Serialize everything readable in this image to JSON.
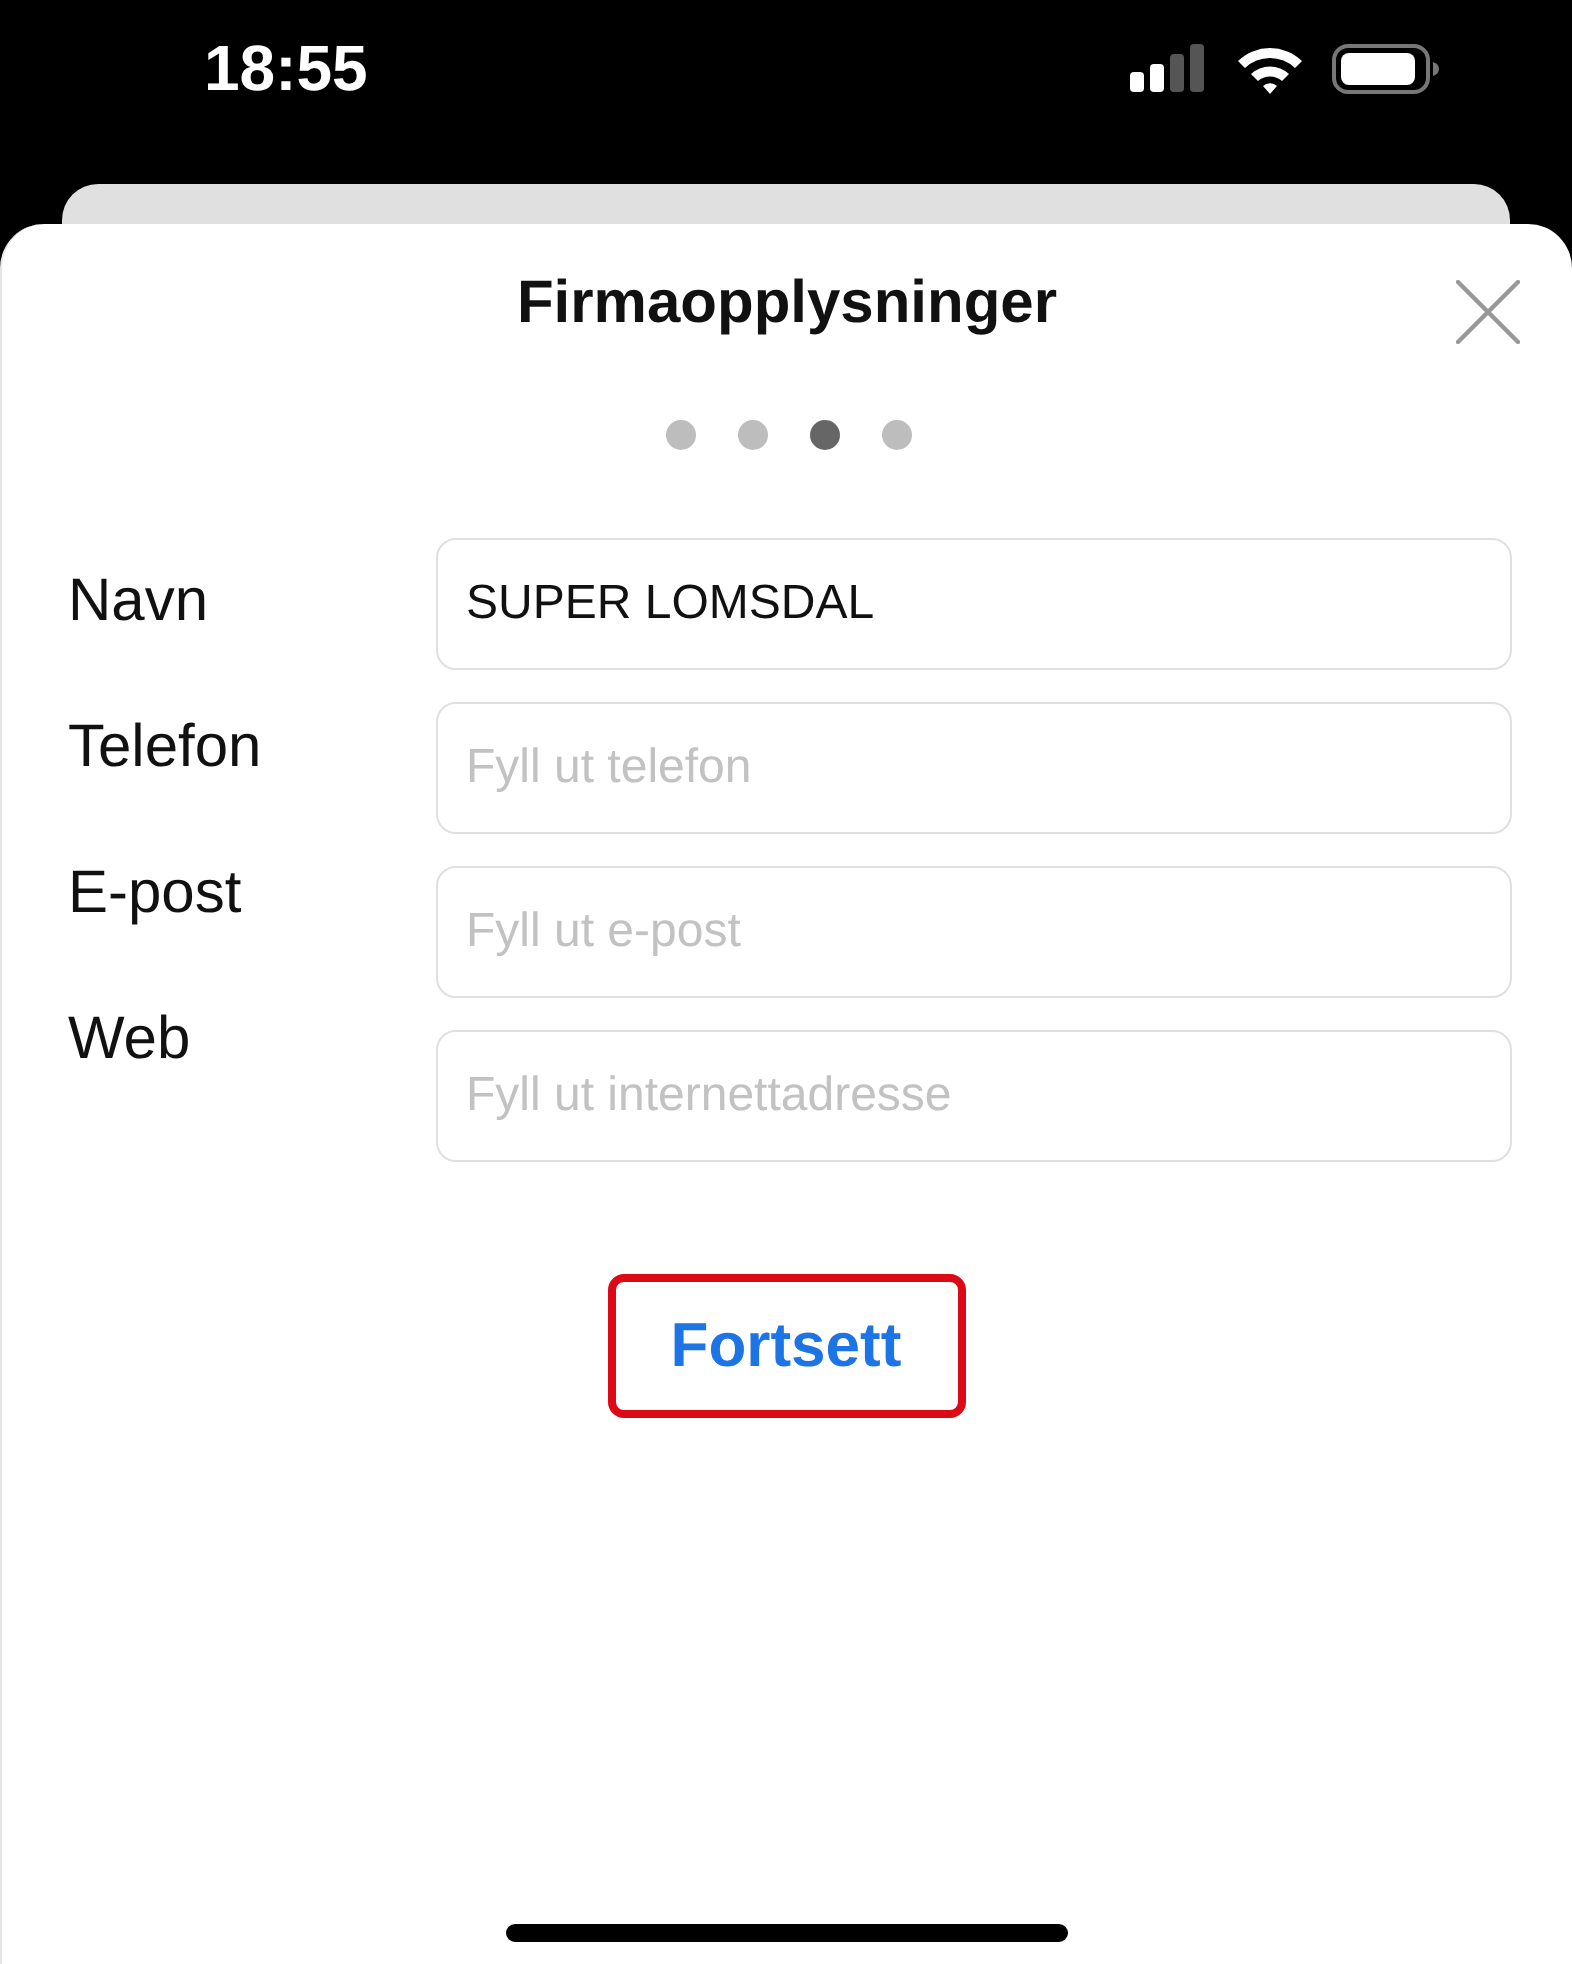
{
  "status_bar": {
    "time": "18:55"
  },
  "sheet": {
    "title": "Firmaopplysninger",
    "steps": [
      {
        "selected": false
      },
      {
        "selected": false
      },
      {
        "selected": true
      },
      {
        "selected": false
      }
    ]
  },
  "fields": [
    {
      "label": "Navn",
      "value": "SUPER LOMSDAL"
    },
    {
      "label": "Telefon",
      "placeholder": "Fyll ut telefon"
    },
    {
      "label": "E-post",
      "placeholder": "Fyll ut e-post"
    },
    {
      "label": "Web",
      "placeholder": "Fyll ut internettadresse"
    }
  ],
  "continue_button": {
    "label": "Fortsett",
    "highlighted": true
  }
}
